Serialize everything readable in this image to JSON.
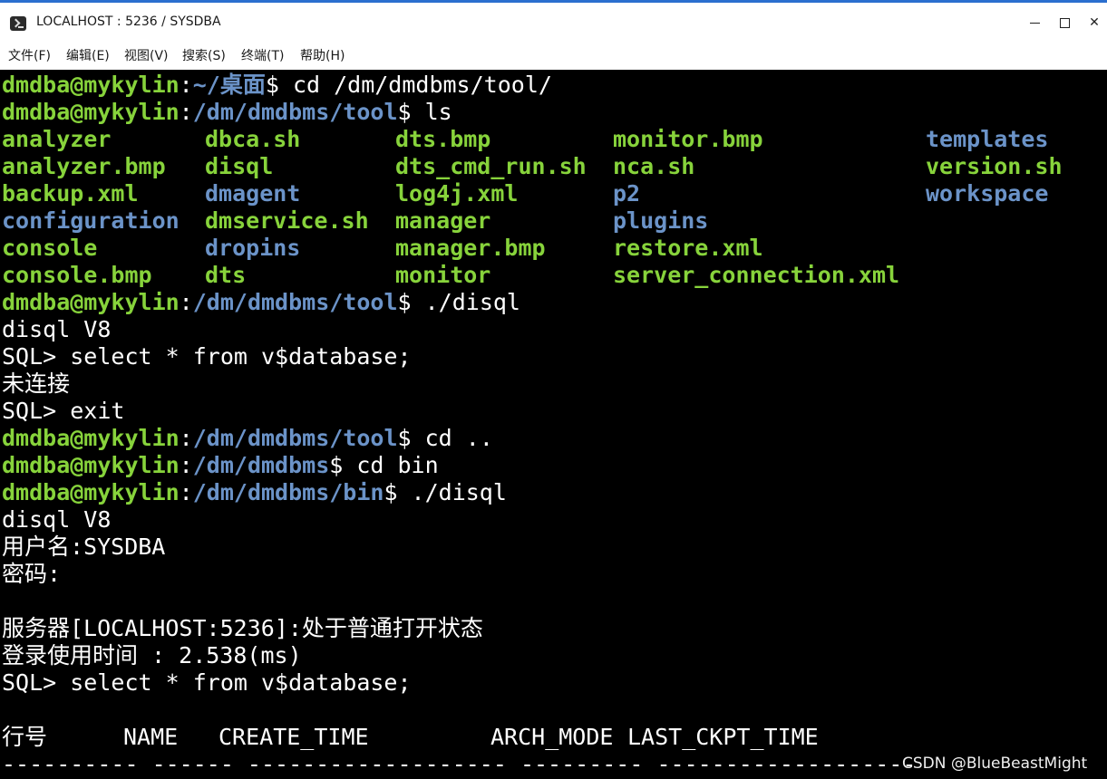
{
  "window": {
    "title": "LOCALHOST : 5236 / SYSDBA",
    "menu": [
      "文件(F)",
      "编辑(E)",
      "视图(V)",
      "搜索(S)",
      "终端(T)",
      "帮助(H)"
    ]
  },
  "prompts": [
    {
      "user": "dmdba@mykylin",
      "sep": ":",
      "path": "~/桌面",
      "tail": "$ cd /dm/dmdbms/tool/"
    },
    {
      "user": "dmdba@mykylin",
      "sep": ":",
      "path": "/dm/dmdbms/tool",
      "tail": "$ ls"
    },
    {
      "user": "dmdba@mykylin",
      "sep": ":",
      "path": "/dm/dmdbms/tool",
      "tail": "$ ./disql"
    },
    {
      "user": "dmdba@mykylin",
      "sep": ":",
      "path": "/dm/dmdbms/tool",
      "tail": "$ cd .."
    },
    {
      "user": "dmdba@mykylin",
      "sep": ":",
      "path": "/dm/dmdbms",
      "tail": "$ cd bin"
    },
    {
      "user": "dmdba@mykylin",
      "sep": ":",
      "path": "/dm/dmdbms/bin",
      "tail": "$ ./disql"
    }
  ],
  "ls": {
    "col1": [
      {
        "name": "analyzer",
        "kind": "exe"
      },
      {
        "name": "analyzer.bmp",
        "kind": "exe"
      },
      {
        "name": "backup.xml",
        "kind": "exe"
      },
      {
        "name": "configuration",
        "kind": "dir"
      },
      {
        "name": "console",
        "kind": "exe"
      },
      {
        "name": "console.bmp",
        "kind": "exe"
      }
    ],
    "col2": [
      {
        "name": "dbca.sh",
        "kind": "exe"
      },
      {
        "name": "disql",
        "kind": "exe"
      },
      {
        "name": "dmagent",
        "kind": "dir"
      },
      {
        "name": "dmservice.sh",
        "kind": "exe"
      },
      {
        "name": "dropins",
        "kind": "dir"
      },
      {
        "name": "dts",
        "kind": "exe"
      }
    ],
    "col3": [
      {
        "name": "dts.bmp",
        "kind": "exe"
      },
      {
        "name": "dts_cmd_run.sh",
        "kind": "exe"
      },
      {
        "name": "log4j.xml",
        "kind": "exe"
      },
      {
        "name": "manager",
        "kind": "exe"
      },
      {
        "name": "manager.bmp",
        "kind": "exe"
      },
      {
        "name": "monitor",
        "kind": "exe"
      }
    ],
    "col4": [
      {
        "name": "monitor.bmp",
        "kind": "exe"
      },
      {
        "name": "nca.sh",
        "kind": "exe"
      },
      {
        "name": "p2",
        "kind": "dir"
      },
      {
        "name": "plugins",
        "kind": "dir"
      },
      {
        "name": "restore.xml",
        "kind": "exe"
      },
      {
        "name": "server_connection.xml",
        "kind": "exe"
      }
    ],
    "col5": [
      {
        "name": "templates",
        "kind": "dir"
      },
      {
        "name": "version.sh",
        "kind": "exe"
      },
      {
        "name": "workspace",
        "kind": "dir"
      }
    ]
  },
  "output": {
    "disql1": "disql V8",
    "query1": "SQL> select * from v$database;",
    "not_connected": "未连接",
    "exit": "SQL> exit",
    "disql2": "disql V8",
    "username": "用户名:SYSDBA",
    "password": "密码:",
    "server_state": "服务器[LOCALHOST:5236]:处于普通打开状态",
    "login_time": "登录使用时间 : 2.538(ms)",
    "query2": "SQL> select * from v$database;"
  },
  "result_header": {
    "c1": "行号",
    "c2": "NAME",
    "c3": "CREATE_TIME",
    "c4": "ARCH_MODE",
    "c5": "LAST_CKPT_TIME"
  },
  "separator": "---------- ------ ------------------- --------- -------------------",
  "watermark": "CSDN @BlueBeastMight",
  "colors": {
    "terminal_bg": "#000000",
    "user_green": "#87d33b",
    "path_blue": "#6b93c8",
    "text_white": "#ffffff",
    "title_accent": "#2b6fcf"
  }
}
